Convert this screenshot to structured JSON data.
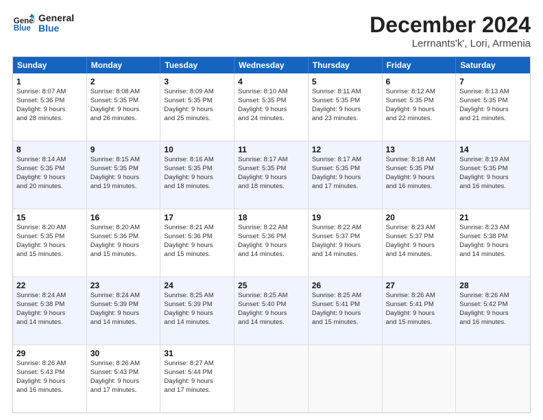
{
  "header": {
    "logo_line1": "General",
    "logo_line2": "Blue",
    "month_title": "December 2024",
    "location": "Lerrnants'k', Lori, Armenia"
  },
  "weekdays": [
    "Sunday",
    "Monday",
    "Tuesday",
    "Wednesday",
    "Thursday",
    "Friday",
    "Saturday"
  ],
  "rows": [
    [
      {
        "day": "1",
        "lines": [
          "Sunrise: 8:07 AM",
          "Sunset: 5:36 PM",
          "Daylight: 9 hours",
          "and 28 minutes."
        ]
      },
      {
        "day": "2",
        "lines": [
          "Sunrise: 8:08 AM",
          "Sunset: 5:35 PM",
          "Daylight: 9 hours",
          "and 26 minutes."
        ]
      },
      {
        "day": "3",
        "lines": [
          "Sunrise: 8:09 AM",
          "Sunset: 5:35 PM",
          "Daylight: 9 hours",
          "and 25 minutes."
        ]
      },
      {
        "day": "4",
        "lines": [
          "Sunrise: 8:10 AM",
          "Sunset: 5:35 PM",
          "Daylight: 9 hours",
          "and 24 minutes."
        ]
      },
      {
        "day": "5",
        "lines": [
          "Sunrise: 8:11 AM",
          "Sunset: 5:35 PM",
          "Daylight: 9 hours",
          "and 23 minutes."
        ]
      },
      {
        "day": "6",
        "lines": [
          "Sunrise: 8:12 AM",
          "Sunset: 5:35 PM",
          "Daylight: 9 hours",
          "and 22 minutes."
        ]
      },
      {
        "day": "7",
        "lines": [
          "Sunrise: 8:13 AM",
          "Sunset: 5:35 PM",
          "Daylight: 9 hours",
          "and 21 minutes."
        ]
      }
    ],
    [
      {
        "day": "8",
        "lines": [
          "Sunrise: 8:14 AM",
          "Sunset: 5:35 PM",
          "Daylight: 9 hours",
          "and 20 minutes."
        ]
      },
      {
        "day": "9",
        "lines": [
          "Sunrise: 8:15 AM",
          "Sunset: 5:35 PM",
          "Daylight: 9 hours",
          "and 19 minutes."
        ]
      },
      {
        "day": "10",
        "lines": [
          "Sunrise: 8:16 AM",
          "Sunset: 5:35 PM",
          "Daylight: 9 hours",
          "and 18 minutes."
        ]
      },
      {
        "day": "11",
        "lines": [
          "Sunrise: 8:17 AM",
          "Sunset: 5:35 PM",
          "Daylight: 9 hours",
          "and 18 minutes."
        ]
      },
      {
        "day": "12",
        "lines": [
          "Sunrise: 8:17 AM",
          "Sunset: 5:35 PM",
          "Daylight: 9 hours",
          "and 17 minutes."
        ]
      },
      {
        "day": "13",
        "lines": [
          "Sunrise: 8:18 AM",
          "Sunset: 5:35 PM",
          "Daylight: 9 hours",
          "and 16 minutes."
        ]
      },
      {
        "day": "14",
        "lines": [
          "Sunrise: 8:19 AM",
          "Sunset: 5:35 PM",
          "Daylight: 9 hours",
          "and 16 minutes."
        ]
      }
    ],
    [
      {
        "day": "15",
        "lines": [
          "Sunrise: 8:20 AM",
          "Sunset: 5:35 PM",
          "Daylight: 9 hours",
          "and 15 minutes."
        ]
      },
      {
        "day": "16",
        "lines": [
          "Sunrise: 8:20 AM",
          "Sunset: 5:36 PM",
          "Daylight: 9 hours",
          "and 15 minutes."
        ]
      },
      {
        "day": "17",
        "lines": [
          "Sunrise: 8:21 AM",
          "Sunset: 5:36 PM",
          "Daylight: 9 hours",
          "and 15 minutes."
        ]
      },
      {
        "day": "18",
        "lines": [
          "Sunrise: 8:22 AM",
          "Sunset: 5:36 PM",
          "Daylight: 9 hours",
          "and 14 minutes."
        ]
      },
      {
        "day": "19",
        "lines": [
          "Sunrise: 8:22 AM",
          "Sunset: 5:37 PM",
          "Daylight: 9 hours",
          "and 14 minutes."
        ]
      },
      {
        "day": "20",
        "lines": [
          "Sunrise: 8:23 AM",
          "Sunset: 5:37 PM",
          "Daylight: 9 hours",
          "and 14 minutes."
        ]
      },
      {
        "day": "21",
        "lines": [
          "Sunrise: 8:23 AM",
          "Sunset: 5:38 PM",
          "Daylight: 9 hours",
          "and 14 minutes."
        ]
      }
    ],
    [
      {
        "day": "22",
        "lines": [
          "Sunrise: 8:24 AM",
          "Sunset: 5:38 PM",
          "Daylight: 9 hours",
          "and 14 minutes."
        ]
      },
      {
        "day": "23",
        "lines": [
          "Sunrise: 8:24 AM",
          "Sunset: 5:39 PM",
          "Daylight: 9 hours",
          "and 14 minutes."
        ]
      },
      {
        "day": "24",
        "lines": [
          "Sunrise: 8:25 AM",
          "Sunset: 5:39 PM",
          "Daylight: 9 hours",
          "and 14 minutes."
        ]
      },
      {
        "day": "25",
        "lines": [
          "Sunrise: 8:25 AM",
          "Sunset: 5:40 PM",
          "Daylight: 9 hours",
          "and 14 minutes."
        ]
      },
      {
        "day": "26",
        "lines": [
          "Sunrise: 8:25 AM",
          "Sunset: 5:41 PM",
          "Daylight: 9 hours",
          "and 15 minutes."
        ]
      },
      {
        "day": "27",
        "lines": [
          "Sunrise: 8:26 AM",
          "Sunset: 5:41 PM",
          "Daylight: 9 hours",
          "and 15 minutes."
        ]
      },
      {
        "day": "28",
        "lines": [
          "Sunrise: 8:26 AM",
          "Sunset: 5:42 PM",
          "Daylight: 9 hours",
          "and 16 minutes."
        ]
      }
    ],
    [
      {
        "day": "29",
        "lines": [
          "Sunrise: 8:26 AM",
          "Sunset: 5:43 PM",
          "Daylight: 9 hours",
          "and 16 minutes."
        ]
      },
      {
        "day": "30",
        "lines": [
          "Sunrise: 8:26 AM",
          "Sunset: 5:43 PM",
          "Daylight: 9 hours",
          "and 17 minutes."
        ]
      },
      {
        "day": "31",
        "lines": [
          "Sunrise: 8:27 AM",
          "Sunset: 5:44 PM",
          "Daylight: 9 hours",
          "and 17 minutes."
        ]
      },
      {
        "day": "",
        "lines": []
      },
      {
        "day": "",
        "lines": []
      },
      {
        "day": "",
        "lines": []
      },
      {
        "day": "",
        "lines": []
      }
    ]
  ],
  "alt_rows": [
    1,
    3
  ]
}
